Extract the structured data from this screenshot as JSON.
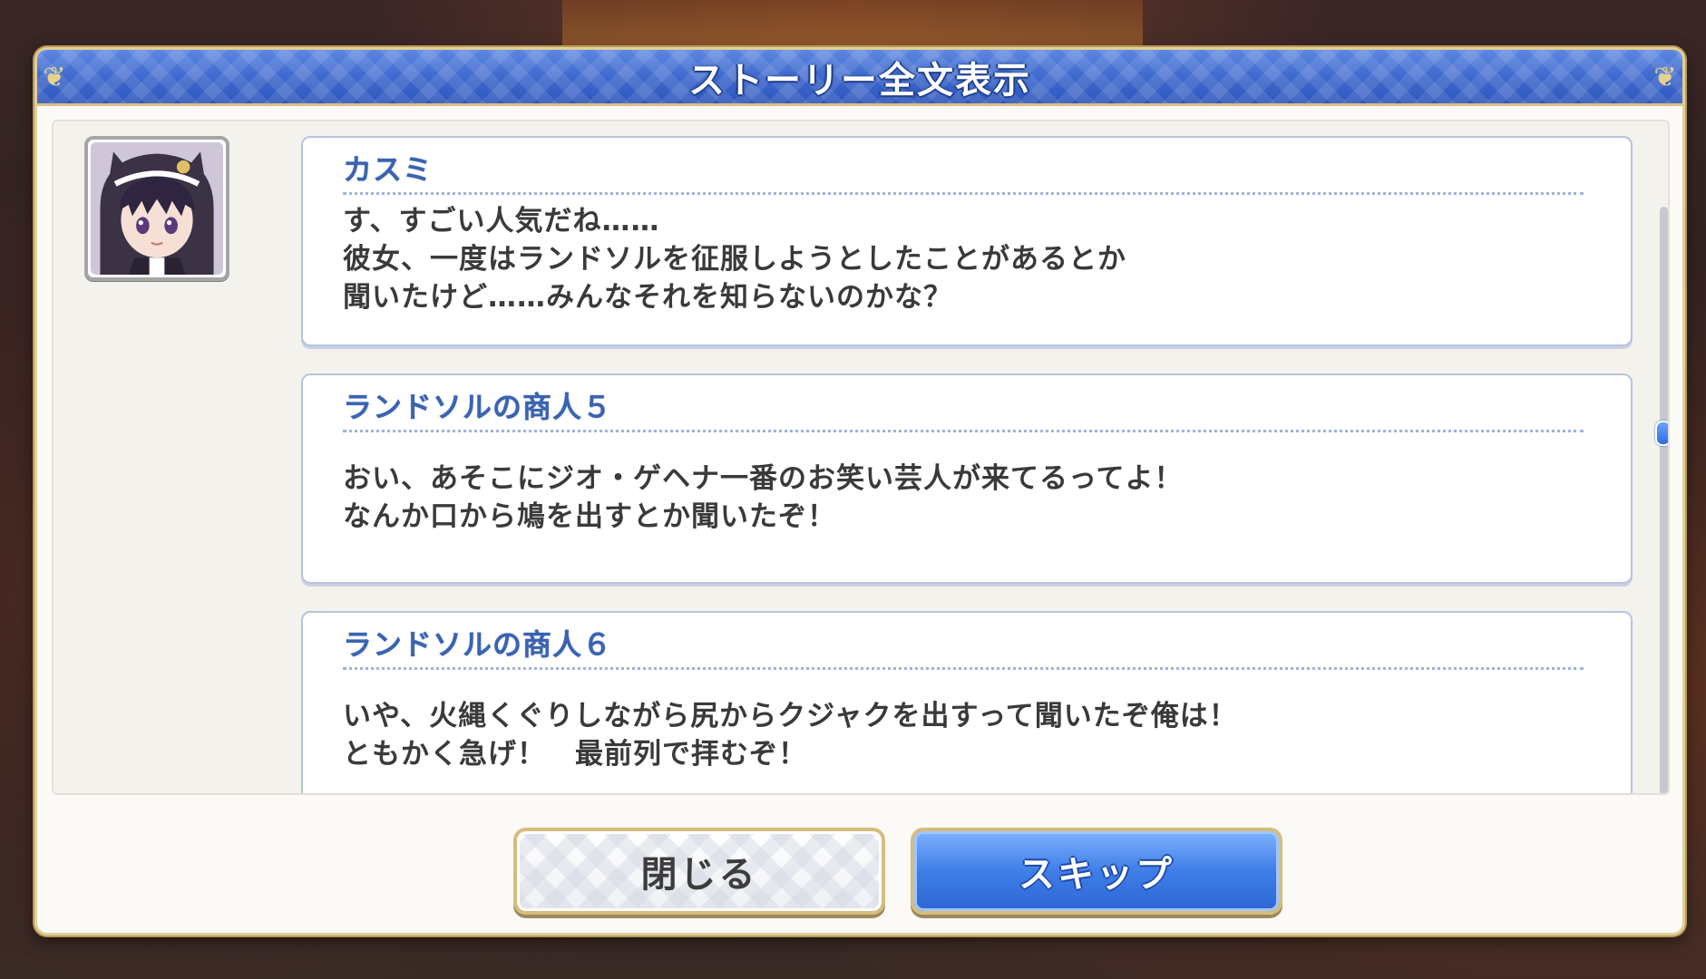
{
  "dialog": {
    "title": "ストーリー全文表示"
  },
  "messages": [
    {
      "speaker": "カスミ",
      "has_avatar": true,
      "lines": [
        "す、すごい人気だね……",
        "彼女、一度はランドソルを征服しようとしたことがあるとか",
        "聞いたけど……みんなそれを知らないのかな？"
      ]
    },
    {
      "speaker": "ランドソルの商人５",
      "has_avatar": false,
      "lines": [
        "おい、あそこにジオ・ゲヘナ一番のお笑い芸人が来てるってよ！",
        "なんか口から鳩を出すとか聞いたぞ！"
      ]
    },
    {
      "speaker": "ランドソルの商人６",
      "has_avatar": false,
      "lines": [
        "いや、火縄くぐりしながら尻からクジャクを出すって聞いたぞ俺は！",
        "ともかく急げ！　最前列で拝むぞ！"
      ]
    }
  ],
  "buttons": {
    "close_label": "閉じる",
    "skip_label": "スキップ"
  },
  "colors": {
    "title_bar": "#3d67cc",
    "speaker_text": "#3a63b2",
    "skip_button": "#3f7ee8",
    "gold_border": "#d6bd7c"
  }
}
